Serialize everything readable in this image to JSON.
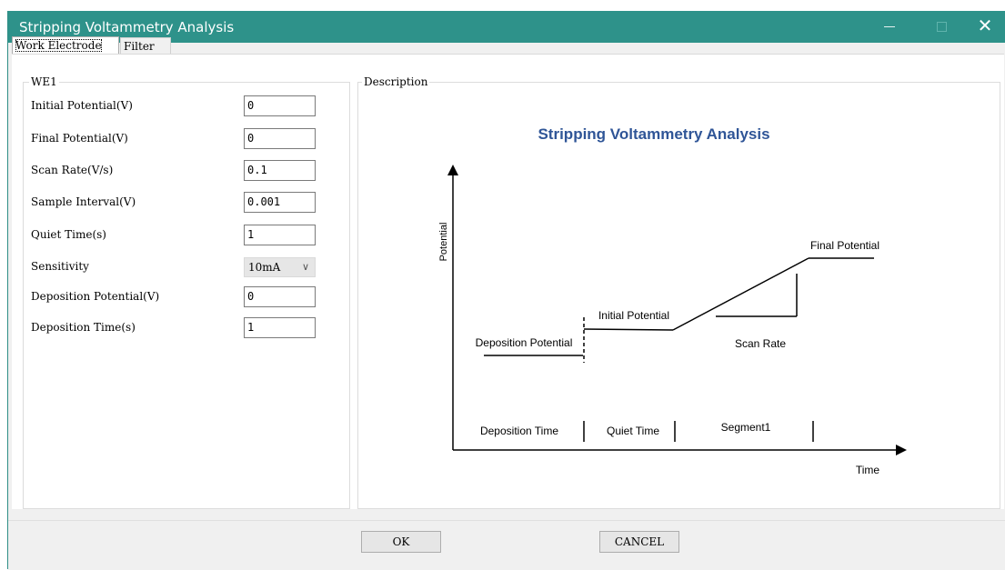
{
  "window": {
    "title": "Stripping Voltammetry Analysis",
    "title_bg": "#2e928a",
    "controls": {
      "minimize": "—",
      "maximize": "□",
      "close": "✕"
    }
  },
  "tabs": [
    {
      "label": "Work Electrode",
      "active": true
    },
    {
      "label": "Filter",
      "active": false
    }
  ],
  "we1": {
    "legend": "WE1",
    "fields": [
      {
        "label": "Initial Potential(V)",
        "value": "0"
      },
      {
        "label": "Final Potential(V)",
        "value": "0"
      },
      {
        "label": "Scan Rate(V/s)",
        "value": "0.1"
      },
      {
        "label": "Sample Interval(V)",
        "value": "0.001"
      },
      {
        "label": "Quiet Time(s)",
        "value": "1"
      }
    ],
    "sensitivity": {
      "label": "Sensitivity",
      "value": "10mA"
    },
    "fields2": [
      {
        "label": "Deposition Potential(V)",
        "value": "0"
      },
      {
        "label": "Deposition Time(s)",
        "value": "1"
      }
    ]
  },
  "description": {
    "legend": "Description",
    "diagram": {
      "title": "Stripping Voltammetry Analysis",
      "title_color": "#2f5597",
      "y_axis_label": "Potential",
      "x_axis_label": "Time",
      "labels": {
        "final_potential": "Final Potential",
        "initial_potential": "Initial Potential",
        "deposition_potential": "Deposition Potential",
        "scan_rate": "Scan Rate"
      },
      "segments": [
        "Deposition Time",
        "Quiet Time",
        "Segment1"
      ]
    }
  },
  "buttons": {
    "ok": "OK",
    "cancel": "CANCEL"
  }
}
